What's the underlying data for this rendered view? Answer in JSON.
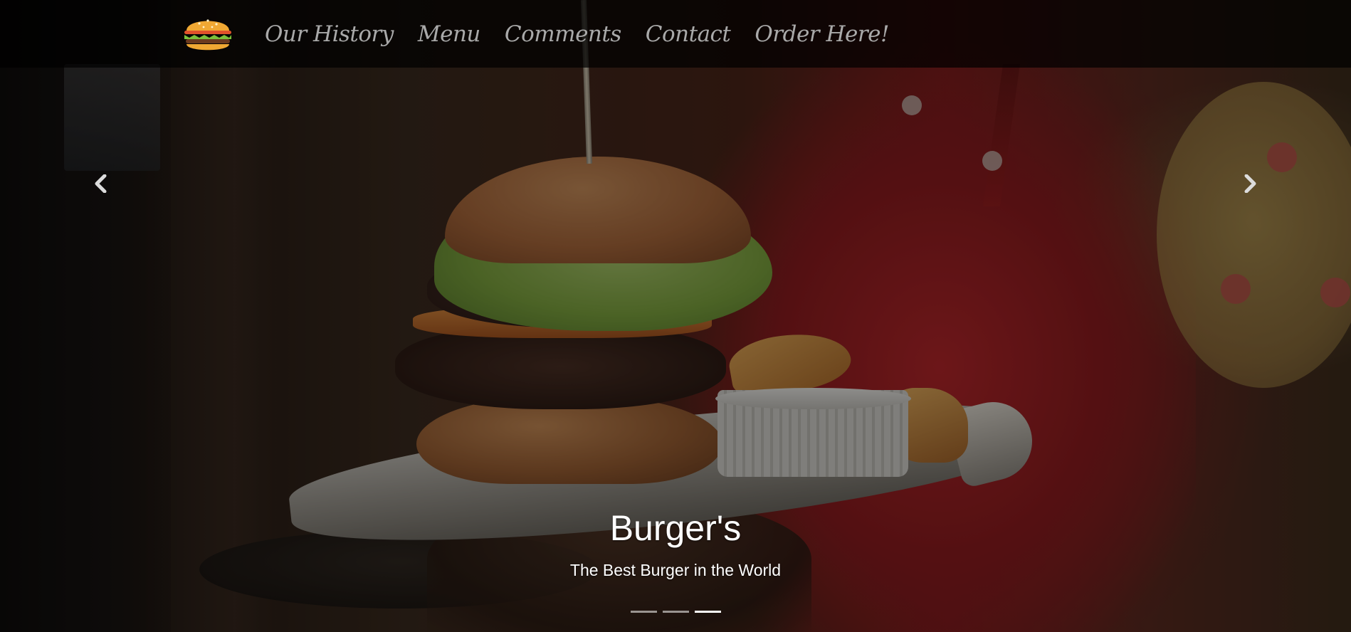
{
  "nav": {
    "logo_icon": "burger-logo-icon",
    "links": [
      {
        "label": "Our History"
      },
      {
        "label": "Menu"
      },
      {
        "label": "Comments"
      },
      {
        "label": "Contact"
      },
      {
        "label": "Order Here!"
      }
    ]
  },
  "carousel": {
    "prev_icon": "chevron-left-icon",
    "next_icon": "chevron-right-icon",
    "caption": {
      "title": "Burger's",
      "text": "The Best Burger in the World"
    },
    "indicator_count": 3,
    "active_index": 2
  },
  "colors": {
    "nav_text": "#a9a9a9",
    "caption_text": "#ffffff",
    "shirt_red": "#b5262a"
  }
}
